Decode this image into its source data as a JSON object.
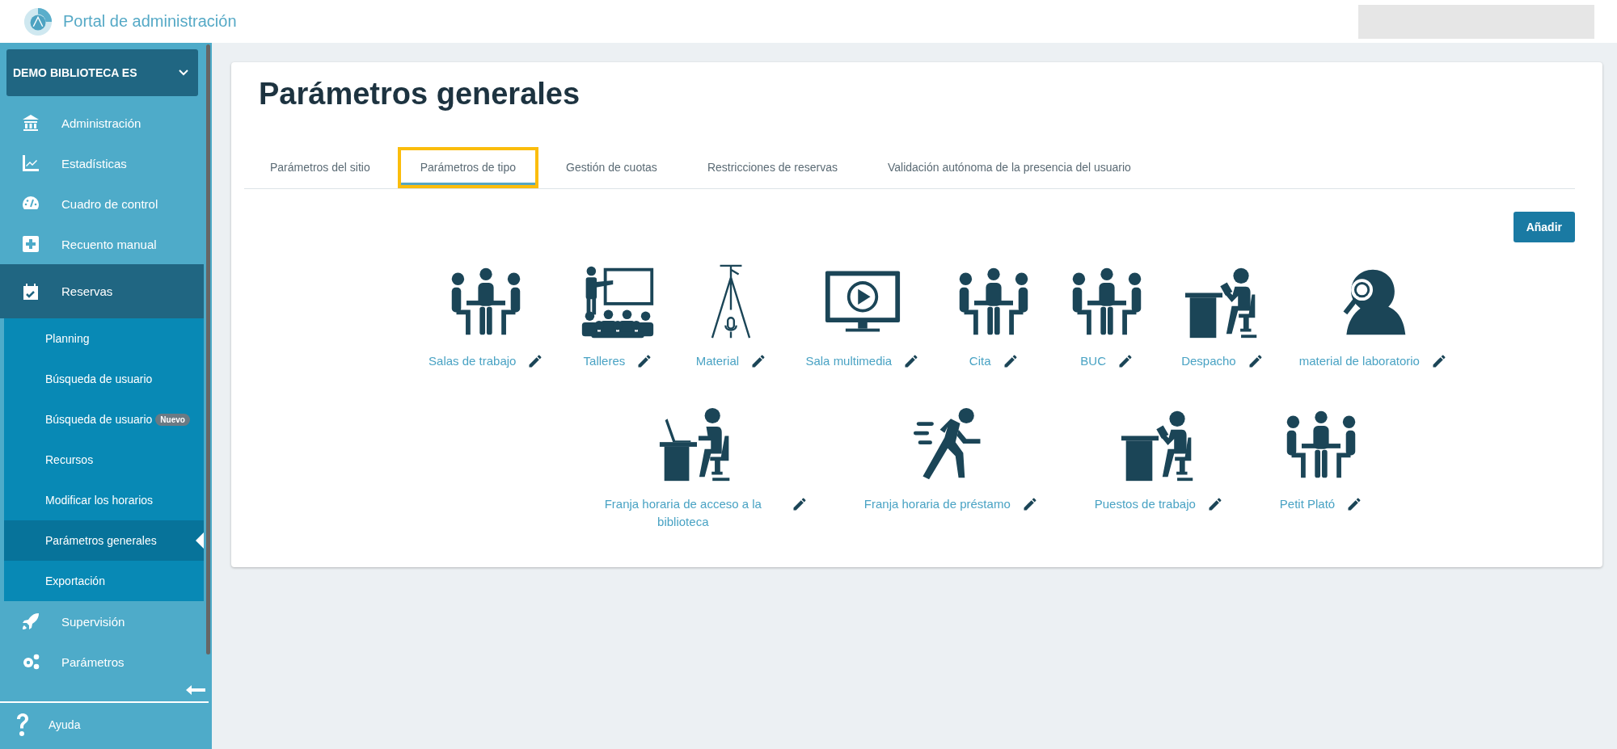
{
  "header": {
    "title": "Portal de administración"
  },
  "sidebar": {
    "library": "DEMO BIBLIOTECA ES",
    "items": [
      {
        "label": "Administración",
        "kind": "bank",
        "expanded": false
      },
      {
        "label": "Estadísticas",
        "kind": "chart",
        "expanded": false
      },
      {
        "label": "Cuadro de control",
        "kind": "gauge",
        "expanded": false
      },
      {
        "label": "Recuento manual",
        "kind": "plus",
        "expanded": false
      },
      {
        "label": "Reservas",
        "kind": "calendar",
        "expanded": true,
        "children": [
          {
            "label": "Planning",
            "selected": false
          },
          {
            "label": "Búsqueda de usuario",
            "selected": false
          },
          {
            "label": "Búsqueda de usuario",
            "badge": "Nuevo",
            "selected": false
          },
          {
            "label": "Recursos",
            "selected": false
          },
          {
            "label": "Modificar los horarios",
            "selected": false
          },
          {
            "label": "Parámetros generales",
            "selected": true
          },
          {
            "label": "Exportación",
            "selected": false
          }
        ]
      },
      {
        "label": "Supervisión",
        "kind": "rocket",
        "expanded": false
      },
      {
        "label": "Parámetros",
        "kind": "gears",
        "expanded": false
      }
    ],
    "help": "Ayuda"
  },
  "page": {
    "title": "Parámetros generales",
    "tabs": [
      {
        "label": "Parámetros del sitio",
        "selected": false,
        "highlighted": false
      },
      {
        "label": "Parámetros de tipo",
        "selected": true,
        "highlighted": true
      },
      {
        "label": "Gestión de cuotas",
        "selected": false,
        "highlighted": false
      },
      {
        "label": "Restricciones de reservas",
        "selected": false,
        "highlighted": false
      },
      {
        "label": "Validación autónoma de la presencia del usuario",
        "selected": false,
        "highlighted": false
      }
    ],
    "add_button": "Añadir",
    "types": [
      [
        {
          "label": "Salas de trabajo",
          "kind": "meeting"
        },
        {
          "label": "Talleres",
          "kind": "teacher"
        },
        {
          "label": "Material",
          "kind": "tripod"
        },
        {
          "label": "Sala multimedia",
          "kind": "monitor"
        },
        {
          "label": "Cita",
          "kind": "meeting"
        },
        {
          "label": "BUC",
          "kind": "meeting"
        },
        {
          "label": "Despacho",
          "kind": "reader"
        },
        {
          "label": "material de laboratorio",
          "kind": "magnifier"
        }
      ],
      [
        {
          "label": "Franja horaria de acceso a la biblioteca",
          "kind": "laptop"
        },
        {
          "label": "Franja horaria de préstamo",
          "kind": "runner"
        },
        {
          "label": "Puestos de trabajo",
          "kind": "reader"
        },
        {
          "label": "Petit Plató",
          "kind": "meeting"
        }
      ]
    ]
  }
}
